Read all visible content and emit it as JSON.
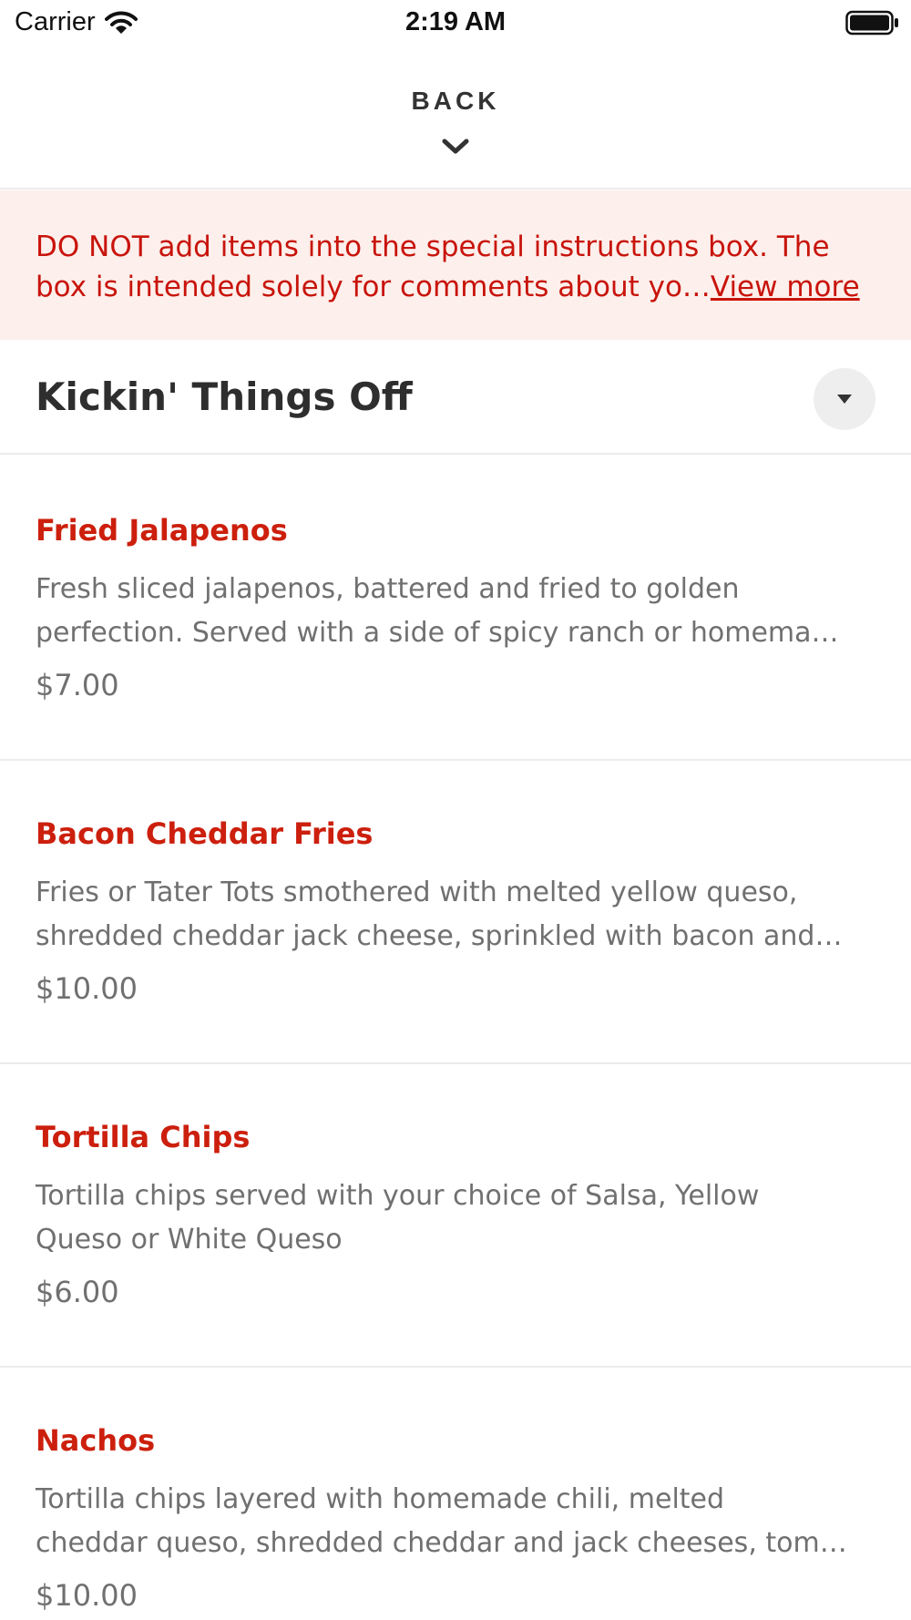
{
  "status_bar": {
    "carrier": "Carrier",
    "time": "2:19 AM"
  },
  "header": {
    "back_label": "BACK",
    "chevron_icon": "chevron-down-icon"
  },
  "notice": {
    "text": "DO NOT add items into the special instructions box. The box is intended solely for comments about yo…",
    "link": "View more",
    "text_color": "#c8140c",
    "background": "#fdefeb"
  },
  "section": {
    "title": "Kickin' Things Off",
    "toggle_icon": "caret-down-icon"
  },
  "items": [
    {
      "name": "Fried Jalapenos",
      "description": "Fresh sliced jalapenos, battered and fried to golden\nperfection. Served with a side of spicy ranch or homema…",
      "price": "$7.00"
    },
    {
      "name": "Bacon Cheddar Fries",
      "description": "Fries or Tater Tots smothered with melted yellow queso,\nshredded cheddar jack cheese, sprinkled with bacon and…",
      "price": "$10.00"
    },
    {
      "name": "Tortilla Chips",
      "description": "Tortilla chips served with your choice of Salsa, Yellow\nQueso or White Queso",
      "price": "$6.00"
    },
    {
      "name": "Nachos",
      "description": "Tortilla chips layered with homemade chili, melted\ncheddar queso, shredded cheddar and jack cheeses, tom…",
      "price": "$10.00"
    }
  ],
  "colors": {
    "accent": "#cc1f0d",
    "muted_text": "#707070",
    "divider": "#ececec"
  }
}
